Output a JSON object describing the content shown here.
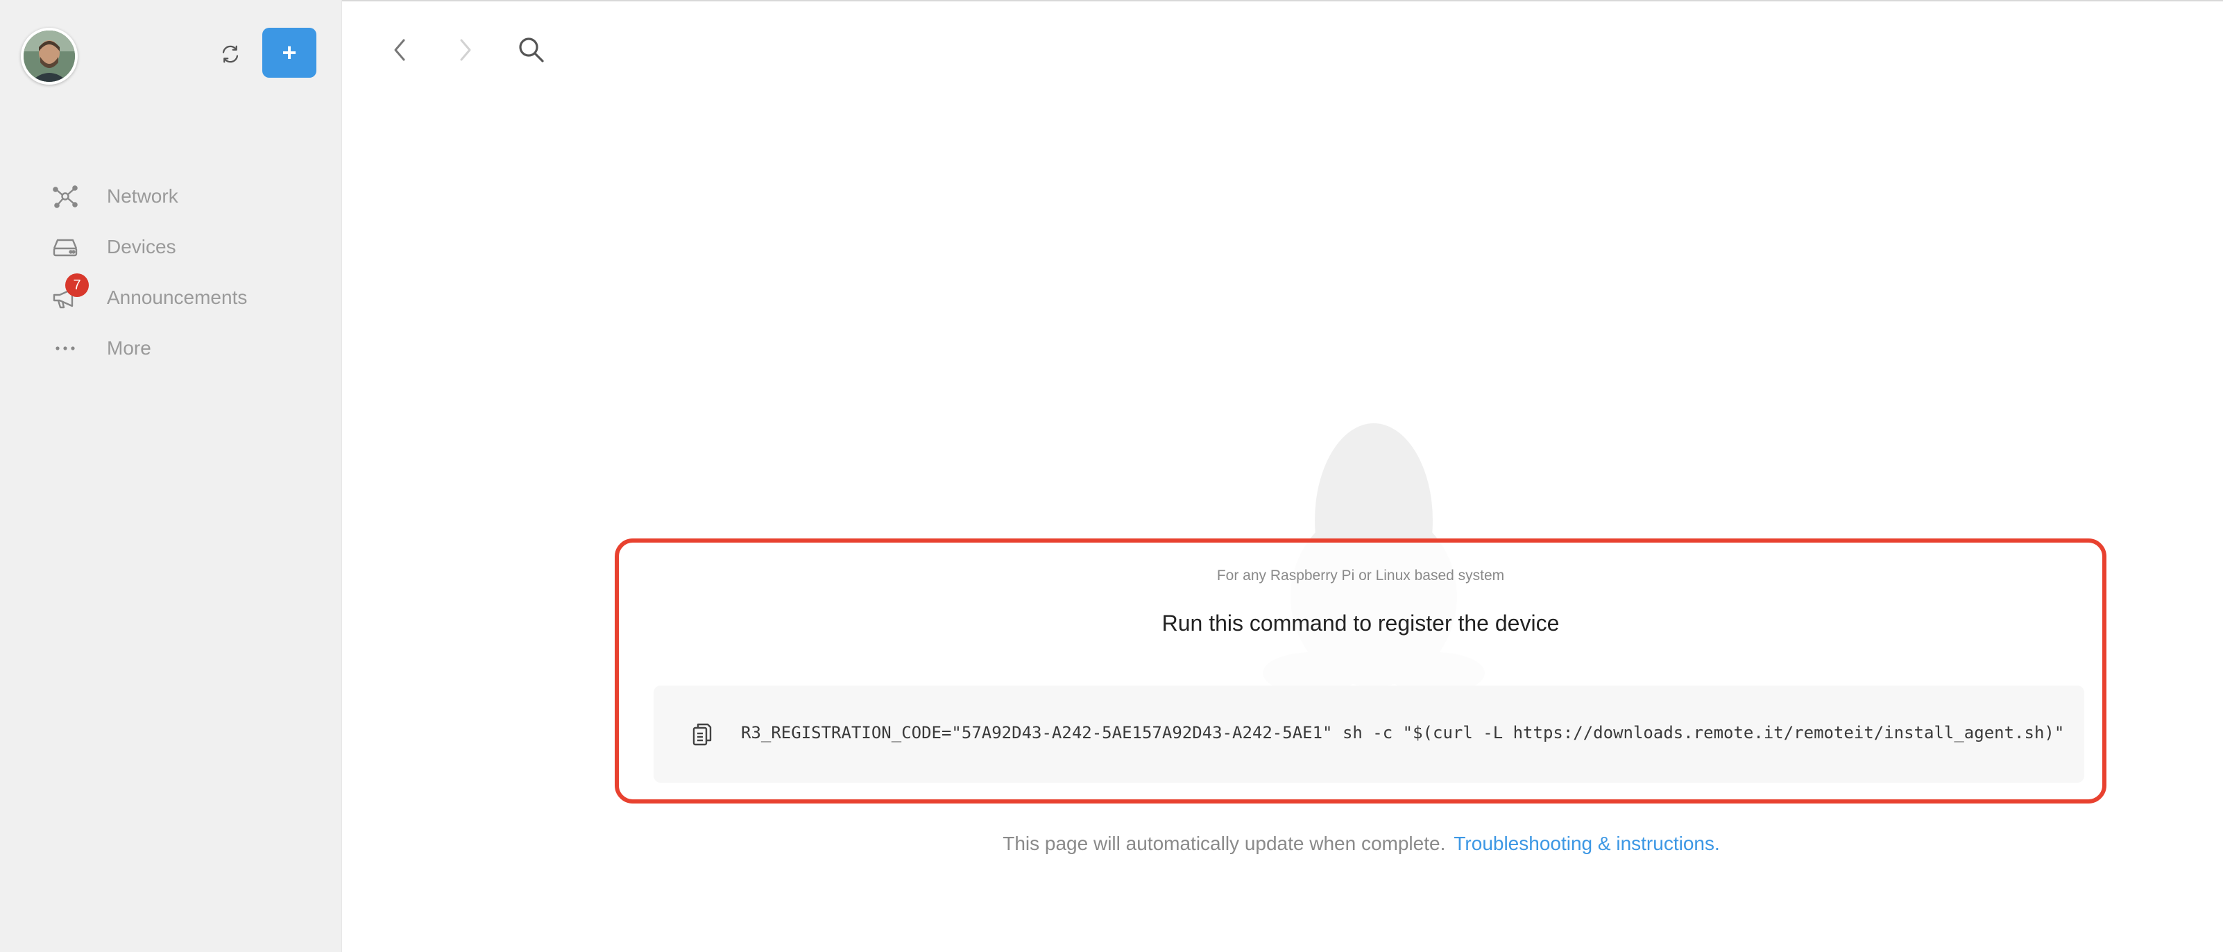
{
  "sidebar": {
    "nav": [
      {
        "label": "Network",
        "icon": "network-icon"
      },
      {
        "label": "Devices",
        "icon": "devices-icon"
      },
      {
        "label": "Announcements",
        "icon": "megaphone-icon",
        "badge": "7"
      },
      {
        "label": "More",
        "icon": "more-icon"
      }
    ],
    "add_label": "+"
  },
  "main": {
    "subtitle": "For any Raspberry Pi or Linux based system",
    "title": "Run this command to register the device",
    "command": "R3_REGISTRATION_CODE=\"57A92D43-A242-5AE157A92D43-A242-5AE1\" sh -c \"$(curl -L https://downloads.remote.it/remoteit/install_agent.sh)\"",
    "footer_text": "This page will automatically update when complete.",
    "footer_link": "Troubleshooting & instructions."
  },
  "colors": {
    "accent": "#3c97e4",
    "highlight": "#e8412f",
    "badge": "#d8382c"
  }
}
